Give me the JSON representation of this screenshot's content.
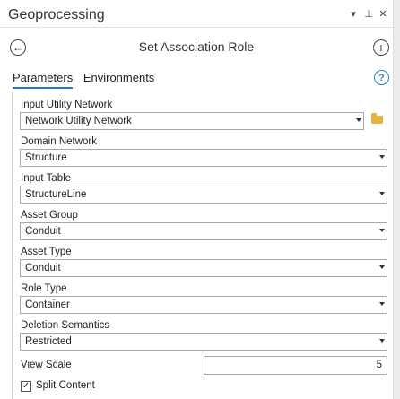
{
  "pane": {
    "title": "Geoprocessing",
    "controls": [
      "▾",
      "⊥",
      "✕"
    ]
  },
  "tool": {
    "title": "Set Association Role",
    "back_glyph": "←",
    "add_glyph": "+"
  },
  "tabs": [
    {
      "label": "Parameters"
    },
    {
      "label": "Environments"
    }
  ],
  "help_glyph": "?",
  "params": [
    {
      "label": "Input Utility Network",
      "value": "Network Utility Network"
    },
    {
      "label": "Domain Network",
      "value": "Structure"
    },
    {
      "label": "Input Table",
      "value": "StructureLine"
    },
    {
      "label": "Asset Group",
      "value": "Conduit"
    },
    {
      "label": "Asset Type",
      "value": "Conduit"
    },
    {
      "label": "Role Type",
      "value": "Container"
    },
    {
      "label": "Deletion Semantics",
      "value": "Restricted"
    }
  ],
  "view_scale": {
    "label": "View Scale",
    "value": "5"
  },
  "split_content": {
    "label": "Split Content",
    "checked": true,
    "check_glyph": "✓"
  }
}
